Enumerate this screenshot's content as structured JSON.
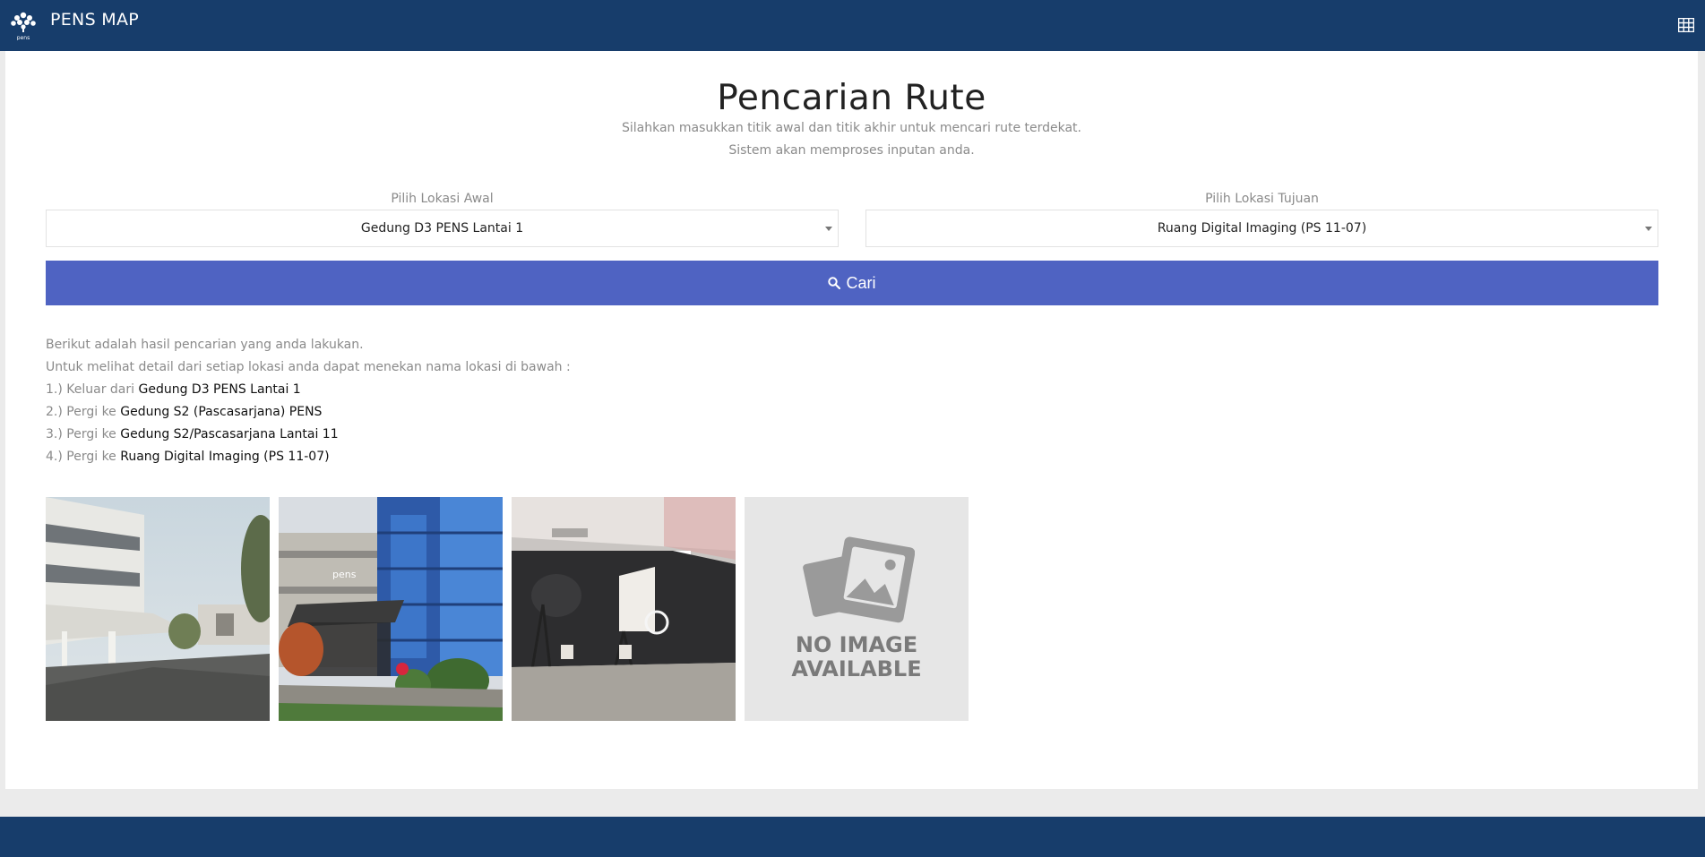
{
  "navbar": {
    "title": "PENS MAP",
    "logo_text": "pens",
    "menu_icon": "grid-icon"
  },
  "page": {
    "title": "Pencarian Rute",
    "subtitle_1": "Silahkan masukkan titik awal dan titik akhir untuk mencari rute terdekat.",
    "subtitle_2": "Sistem akan memproses inputan anda."
  },
  "form": {
    "start_label": "Pilih Lokasi Awal",
    "start_value": "Gedung D3 PENS Lantai 1",
    "dest_label": "Pilih Lokasi Tujuan",
    "dest_value": "Ruang Digital Imaging (PS 11-07)",
    "search_label": "Cari"
  },
  "results": {
    "intro_1": "Berikut adalah hasil pencarian yang anda lakukan.",
    "intro_2": "Untuk melihat detail dari setiap lokasi anda dapat menekan nama lokasi di bawah :",
    "steps": [
      {
        "prefix": "1.) Keluar dari ",
        "location": "Gedung D3 PENS Lantai 1"
      },
      {
        "prefix": "2.) Pergi ke ",
        "location": "Gedung S2 (Pascasarjana) PENS"
      },
      {
        "prefix": "3.) Pergi ke ",
        "location": "Gedung S2/Pascasarjana Lantai 11"
      },
      {
        "prefix": "4.) Pergi ke ",
        "location": "Ruang Digital Imaging (PS 11-07)"
      }
    ]
  },
  "images": {
    "no_image_line1": "NO IMAGE",
    "no_image_line2": "AVAILABLE"
  },
  "colors": {
    "navbar": "#173d6b",
    "button": "#4f63c2",
    "muted_text": "#8a8a8a"
  }
}
